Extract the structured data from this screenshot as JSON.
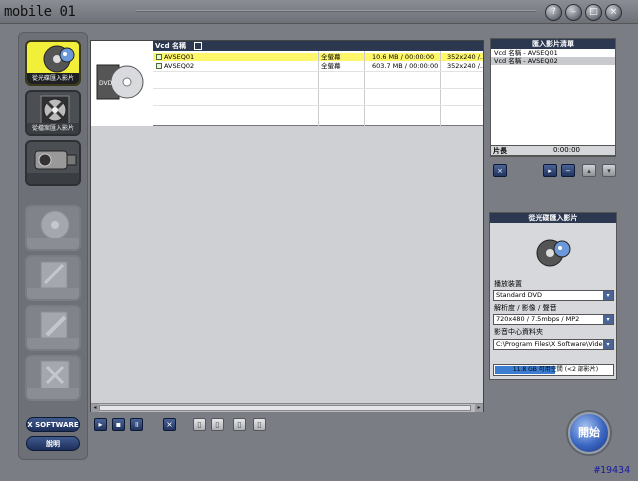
{
  "app": {
    "logo_text": "mobile 01",
    "window_buttons": {
      "help": "?",
      "minimize": "–",
      "maximize": "□",
      "close": "×"
    }
  },
  "nav": {
    "items": [
      {
        "label": "從光碟匯入影片",
        "state": "active"
      },
      {
        "label": "從檔案匯入影片",
        "state": "normal"
      },
      {
        "label": "從攝影機匯入影片",
        "state": "normal"
      }
    ],
    "xsoftware_label": "X SOFTWARE",
    "help_label": "說明"
  },
  "file_list": {
    "header": "Vcd 名稱",
    "rows": [
      {
        "name": "AVSEQ01",
        "mode": "全螢幕",
        "size_time": "10.6 MB / 00:00:00",
        "resolution": "352x240 /..."
      },
      {
        "name": "AVSEQ02",
        "mode": "全螢幕",
        "size_time": "603.7 MB / 00:00:00",
        "resolution": "352x240 /..."
      }
    ]
  },
  "import_list": {
    "title": "匯入影片清單",
    "items": [
      "Vcd 名稱 - AVSEQ01",
      "Vcd 名稱 - AVSEQ02"
    ],
    "length_label": "片長",
    "length_value": "0:00:00"
  },
  "disc_import": {
    "title": "從光碟匯入影片",
    "device_label": "播放裝置",
    "device_value": "Standard DVD",
    "resolution_label": "解析度 / 影像 / 聲音",
    "resolution_value": "720x480 / 7.5mbps / MP2",
    "folder_label": "影音中心資料夾",
    "folder_value": "C:\\Program Files\\X Software\\Video",
    "capacity_text": "11.8 GB 可用空間 (<2 部影片)"
  },
  "start_label": "開始",
  "watermark": "#19434",
  "colors": {
    "accent_yellow": "#f2ef3a",
    "header_navy": "#2c3850",
    "button_blue": "#3a66c2",
    "capacity_blue": "#3d7dd0"
  }
}
